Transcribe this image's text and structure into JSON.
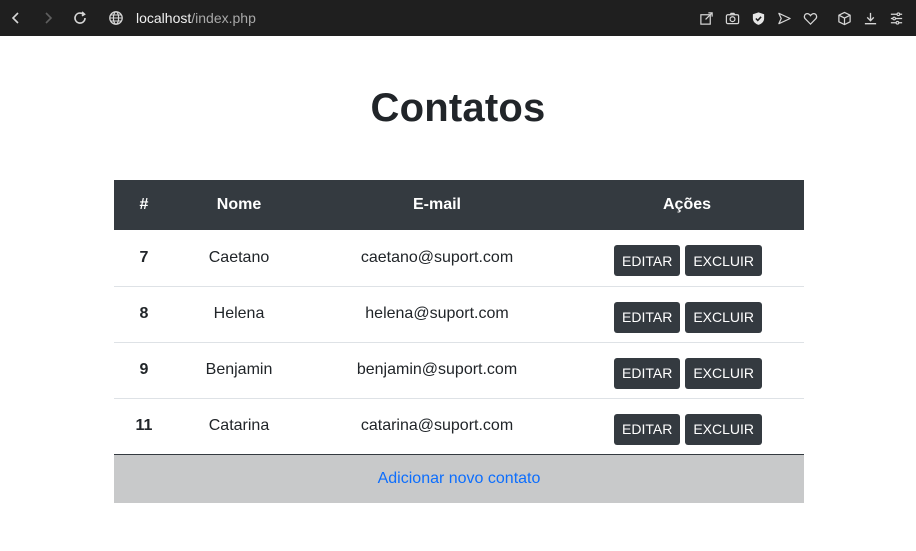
{
  "browser": {
    "url_host": "localhost",
    "url_path": "/index.php"
  },
  "page": {
    "title": "Contatos",
    "table": {
      "headers": [
        "#",
        "Nome",
        "E-mail",
        "Ações"
      ],
      "rows": [
        {
          "id": "7",
          "name": "Caetano",
          "email": "caetano@suport.com"
        },
        {
          "id": "8",
          "name": "Helena",
          "email": "helena@suport.com"
        },
        {
          "id": "9",
          "name": "Benjamin",
          "email": "benjamin@suport.com"
        },
        {
          "id": "11",
          "name": "Catarina",
          "email": "catarina@suport.com"
        }
      ],
      "edit_label": "EDITAR",
      "delete_label": "EXCLUIR"
    },
    "add_link": "Adicionar novo contato"
  },
  "colors": {
    "chrome_bg": "#1f1f1f",
    "header_bg": "#343a40",
    "button_bg": "#343a40",
    "footer_bg": "#c8c9ca",
    "link": "#0d6efd"
  }
}
